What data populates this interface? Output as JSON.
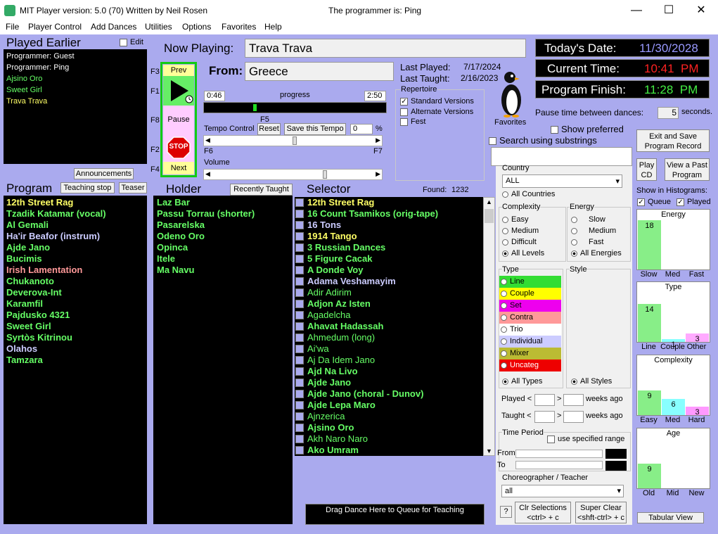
{
  "window": {
    "title": "MIT Player  version: 5.0 (70) Written by Neil Rosen",
    "programmer_title": "The programmer is: Ping"
  },
  "menu": [
    "File",
    "Player Control",
    "Add Dances",
    "Utilities",
    "Options",
    "Favorites",
    "Help"
  ],
  "played_earlier": {
    "title": "Played Earlier",
    "edit_label": "Edit",
    "items": [
      {
        "text": "Programmer: Guest",
        "color": "#ffffff"
      },
      {
        "text": "Programmer: Ping",
        "color": "#ffffff"
      },
      {
        "text": "Ajsino Oro",
        "color": "#66ff66"
      },
      {
        "text": "Sweet Girl",
        "color": "#66ff66"
      },
      {
        "text": "Trava Trava",
        "color": "#ffff66"
      }
    ]
  },
  "announcements_label": "Announcements",
  "now_playing": {
    "label": "Now Playing:",
    "value": "Trava Trava",
    "from_label": "From:",
    "from_value": "Greece",
    "last_played_label": "Last Played:",
    "last_played": "7/17/2024",
    "last_taught_label": "Last Taught:",
    "last_taught": "2/16/2023"
  },
  "controls": {
    "prev": "Prev",
    "pause": "Pause",
    "stop": "STOP",
    "next": "Next",
    "f3": "F3",
    "f1": "F1",
    "f8": "F8",
    "f2": "F2",
    "f4": "F4",
    "f5": "F5",
    "f6": "F6",
    "f7": "F7"
  },
  "progress": {
    "elapsed": "0:46",
    "label": "progress",
    "total": "2:50",
    "fraction": 0.27
  },
  "tempo": {
    "label": "Tempo Control",
    "reset": "Reset",
    "save": "Save this Tempo",
    "value": "0",
    "pct": "%"
  },
  "volume_label": "Volume",
  "repertoire": {
    "title": "Repertoire",
    "items": [
      {
        "label": "Standard Versions",
        "checked": true
      },
      {
        "label": "Alternate Versions",
        "checked": false
      },
      {
        "label": "Fest",
        "checked": false
      }
    ]
  },
  "favorites_label": "Favorites",
  "date": {
    "today_label": "Today's Date:",
    "today": "11/30/2028",
    "time_label": "Current Time:",
    "time": "10:41  PM",
    "finish_label": "Program Finish:",
    "finish": "11:28  PM"
  },
  "pause": {
    "label": "Pause time between dances:",
    "value": "5",
    "unit": "seconds."
  },
  "show_preferred": "Show preferred",
  "search_substrings": "Search using substrings",
  "exit_save": "Exit and Save Program Record",
  "play_cd": "Play CD",
  "view_past": "View a Past Program",
  "program": {
    "title": "Program",
    "teaching_stop": "Teaching stop",
    "teaser": "Teaser",
    "items": [
      {
        "text": "12th Street Rag",
        "color": "#ffff66"
      },
      {
        "text": "Tzadik Katamar (vocal)",
        "color": "#66ff66"
      },
      {
        "text": "Al Gemali",
        "color": "#66ff66"
      },
      {
        "text": "Ha'ir Beafor (instrum)",
        "color": "#ccccff"
      },
      {
        "text": "Ajde Jano",
        "color": "#66ff66"
      },
      {
        "text": "Bucimis",
        "color": "#66ff66"
      },
      {
        "text": "Irish Lamentation",
        "color": "#ff9999"
      },
      {
        "text": "Chukanoto",
        "color": "#66ff66"
      },
      {
        "text": "Deverova-Int",
        "color": "#66ff66"
      },
      {
        "text": "Karamfil",
        "color": "#66ff66"
      },
      {
        "text": "Pajdusko 4321",
        "color": "#66ff66"
      },
      {
        "text": "Sweet Girl",
        "color": "#66ff66"
      },
      {
        "text": "Syrtòs Kitrinou",
        "color": "#66ff66"
      },
      {
        "text": "Olahos",
        "color": "#ccccff"
      },
      {
        "text": "Tamzara",
        "color": "#66ff66"
      }
    ]
  },
  "holder": {
    "title": "Holder",
    "recently_taught": "Recently Taught",
    "items": [
      {
        "text": "Laz Bar",
        "color": "#66ff66"
      },
      {
        "text": "Passu Torrau (shorter)",
        "color": "#66ff66"
      },
      {
        "text": "Pasarelska",
        "color": "#66ff66"
      },
      {
        "text": "Odeno Oro",
        "color": "#66ff66"
      },
      {
        "text": "Opinca",
        "color": "#66ff66"
      },
      {
        "text": "Itele",
        "color": "#66ff66"
      },
      {
        "text": "Ma Navu",
        "color": "#66ff66"
      }
    ]
  },
  "selector": {
    "title": "Selector",
    "found_label": "Found:",
    "found": "1232",
    "drag_label": "Drag Dance Here to Queue for Teaching",
    "items": [
      {
        "text": "12th Street Rag",
        "color": "#ffff66",
        "bold": true
      },
      {
        "text": "16 Count Tsamikos (orig-tape)",
        "color": "#66ff66",
        "bold": true
      },
      {
        "text": "16 Tons",
        "color": "#ccccff",
        "bold": true
      },
      {
        "text": "1914 Tango",
        "color": "#ffff66",
        "bold": true
      },
      {
        "text": "3 Russian Dances",
        "color": "#66ff66",
        "bold": true
      },
      {
        "text": "5 Figure Cacak",
        "color": "#66ff66",
        "bold": true
      },
      {
        "text": "A Donde Voy",
        "color": "#66ff66",
        "bold": true
      },
      {
        "text": "Adama Veshamayim",
        "color": "#ccccff",
        "bold": true
      },
      {
        "text": "Adir Adirim",
        "color": "#66ff66",
        "bold": false
      },
      {
        "text": "Adjon Az Isten",
        "color": "#66ff66",
        "bold": true
      },
      {
        "text": "Agadelcha",
        "color": "#66ff66",
        "bold": false
      },
      {
        "text": "Ahavat Hadassah",
        "color": "#66ff66",
        "bold": true
      },
      {
        "text": "Ahmedum (long)",
        "color": "#66ff66",
        "bold": false
      },
      {
        "text": "Ai'wa",
        "color": "#66ff66",
        "bold": false
      },
      {
        "text": "Aj Da Idem Jano",
        "color": "#66ff66",
        "bold": false
      },
      {
        "text": "Ajd Na Livo",
        "color": "#66ff66",
        "bold": true
      },
      {
        "text": "Ajde Jano",
        "color": "#66ff66",
        "bold": true
      },
      {
        "text": "Ajde Jano (choral - Dunov)",
        "color": "#66ff66",
        "bold": true
      },
      {
        "text": "Ajde Lepa Maro",
        "color": "#66ff66",
        "bold": true
      },
      {
        "text": "Ajnzerica",
        "color": "#66ff66",
        "bold": false
      },
      {
        "text": "Ajsino Oro",
        "color": "#66ff66",
        "bold": true
      },
      {
        "text": "Akh Naro Naro",
        "color": "#66ff66",
        "bold": false
      },
      {
        "text": "Ako Umram",
        "color": "#66ff66",
        "bold": true
      }
    ]
  },
  "filters": {
    "country": {
      "title": "Country",
      "value": "ALL",
      "all": "All Countries"
    },
    "complexity": {
      "title": "Complexity",
      "options": [
        "Easy",
        "Medium",
        "Difficult",
        "All Levels"
      ],
      "selected": "All Levels"
    },
    "energy": {
      "title": "Energy",
      "options": [
        "Slow",
        "Medium",
        "Fast",
        "All Energies"
      ],
      "selected": "All Energies"
    },
    "type": {
      "title": "Type",
      "options": [
        {
          "label": "Line",
          "color": "#33dd33"
        },
        {
          "label": "Couple",
          "color": "#ffff00"
        },
        {
          "label": "Set",
          "color": "#ee00ee"
        },
        {
          "label": "Contra",
          "color": "#ff9999"
        },
        {
          "label": "Trio",
          "color": "#ffffff"
        },
        {
          "label": "Individual",
          "color": "#ccccff"
        },
        {
          "label": "Mixer",
          "color": "#bbbb33"
        },
        {
          "label": "Uncateg",
          "color": "#ee0000"
        }
      ],
      "all": "All Types"
    },
    "style": {
      "title": "Style",
      "all": "All Styles"
    },
    "played_lt": "Played <",
    "taught_lt": "Taught <",
    "gt": ">",
    "weeks_ago": "weeks ago",
    "time_period": {
      "title": "Time Period",
      "use_range": "use specified range",
      "from": "From",
      "to": "To"
    },
    "choreographer": {
      "title": "Choreographer / Teacher",
      "value": "all"
    },
    "help": "?",
    "clr": "Clr Selections <ctrl> + c",
    "super_clear": "Super Clear <shft-ctrl> + c"
  },
  "histograms": {
    "show_label": "Show in Histograms:",
    "queue": "Queue",
    "played": "Played",
    "energy": {
      "title": "Energy",
      "labels": [
        "Slow",
        "Med",
        "Fast"
      ],
      "values": [
        18,
        0,
        0
      ]
    },
    "type": {
      "title": "Type",
      "labels": [
        "Line",
        "Couple",
        "Other"
      ],
      "values": [
        14,
        1,
        3
      ]
    },
    "complexity": {
      "title": "Complexity",
      "labels": [
        "Easy",
        "Med",
        "Hard"
      ],
      "values": [
        9,
        6,
        3
      ]
    },
    "age": {
      "title": "Age",
      "labels": [
        "Old",
        "Mid",
        "New"
      ],
      "values": [
        9,
        0,
        0
      ]
    },
    "tabular": "Tabular View"
  }
}
